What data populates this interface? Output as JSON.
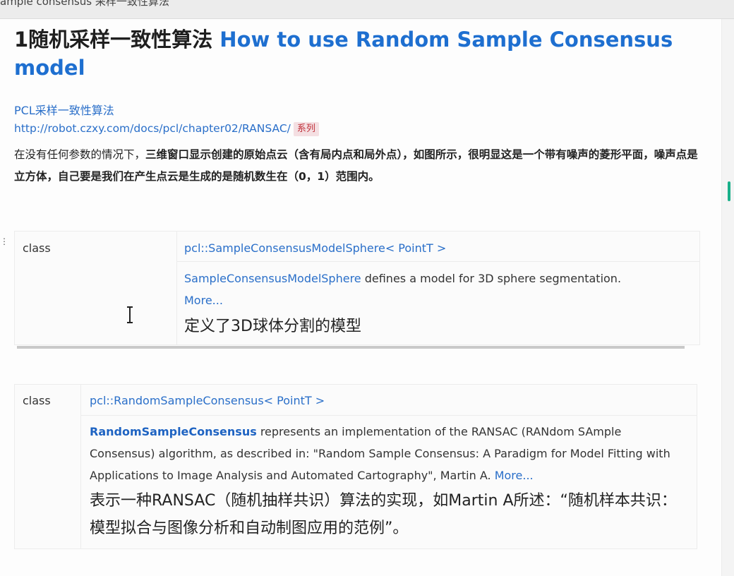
{
  "tab": {
    "title": "ample consensus 采样一致性算法"
  },
  "article": {
    "title_zh": "1随机采样一致性算法",
    "title_en": "How to use Random Sample Consensus model",
    "subtitle_link": "PCL采样一致性算法",
    "url": "http://robot.czxy.com/docs/pcl/chapter02/RANSAC/",
    "tag": "系列",
    "para_normal": "在没有任何参数的情况下，",
    "para_bold": "三维窗口显示创建的原始点云（含有局内点和局外点），如图所示，很明显这是一个带有噪声的菱形平面，噪声点是立方体，自己要是我们在产生点云是生成的是随机数生在（0，1）范围内。"
  },
  "classes": [
    {
      "kind": "class",
      "signature": "pcl::SampleConsensusModelSphere< PointT >",
      "desc_link": "SampleConsensusModelSphere",
      "desc_text": " defines a model for 3D sphere segmentation.",
      "more": "More...",
      "zh": "定义了3D球体分割的模型"
    },
    {
      "kind": "class",
      "signature": "pcl::RandomSampleConsensus< PointT >",
      "desc_link": "RandomSampleConsensus",
      "desc_text": " represents an implementation of the RANSAC (RANdom SAmple Consensus) algorithm, as described in: \"Random Sample Consensus: A Paradigm for Model Fitting with Applications to Image Analysis and Automated Cartography\", Martin A. ",
      "more": "More...",
      "zh": "表示一种RANSAC（随机抽样共识）算法的实现，如Martin A所述：“随机样本共识：模型拟合与图像分析和自动制图应用的范例”。"
    }
  ]
}
